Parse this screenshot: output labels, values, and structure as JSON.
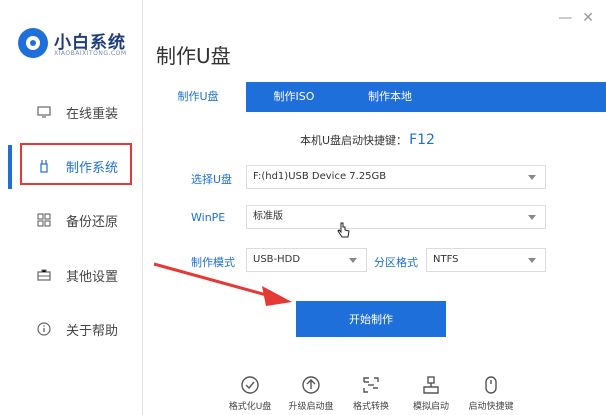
{
  "app": {
    "name": "小白系统",
    "subtitle": "XIAOBAIXITONG.COM"
  },
  "window": {
    "minimize": "—",
    "close": "✕"
  },
  "sidebar": {
    "items": [
      {
        "label": "在线重装",
        "icon": "monitor-icon"
      },
      {
        "label": "制作系统",
        "icon": "usb-icon"
      },
      {
        "label": "备份还原",
        "icon": "grid-icon"
      },
      {
        "label": "其他设置",
        "icon": "briefcase-icon"
      },
      {
        "label": "关于帮助",
        "icon": "info-icon"
      }
    ]
  },
  "main": {
    "title": "制作U盘",
    "tabs": [
      {
        "label": "制作U盘"
      },
      {
        "label": "制作ISO"
      },
      {
        "label": "制作本地"
      }
    ],
    "hotkey_label": "本机U盘启动快捷键：",
    "hotkey_value": "F12",
    "select_usb_label": "选择U盘",
    "select_usb_value": "F:(hd1)USB Device 7.25GB",
    "winpe_label": "WinPE",
    "winpe_value": "标准版",
    "mode_label": "制作模式",
    "mode_value": "USB-HDD",
    "partition_label": "分区格式",
    "partition_value": "NTFS",
    "start_button": "开始制作"
  },
  "tools": [
    {
      "label": "格式化U盘",
      "icon": "check-circle-icon"
    },
    {
      "label": "升级启动盘",
      "icon": "upload-circle-icon"
    },
    {
      "label": "格式转换",
      "icon": "convert-icon"
    },
    {
      "label": "模拟启动",
      "icon": "simulate-icon"
    },
    {
      "label": "启动快捷键",
      "icon": "mouse-icon"
    }
  ],
  "colors": {
    "accent": "#1e6fd9",
    "highlight": "#e53935"
  }
}
